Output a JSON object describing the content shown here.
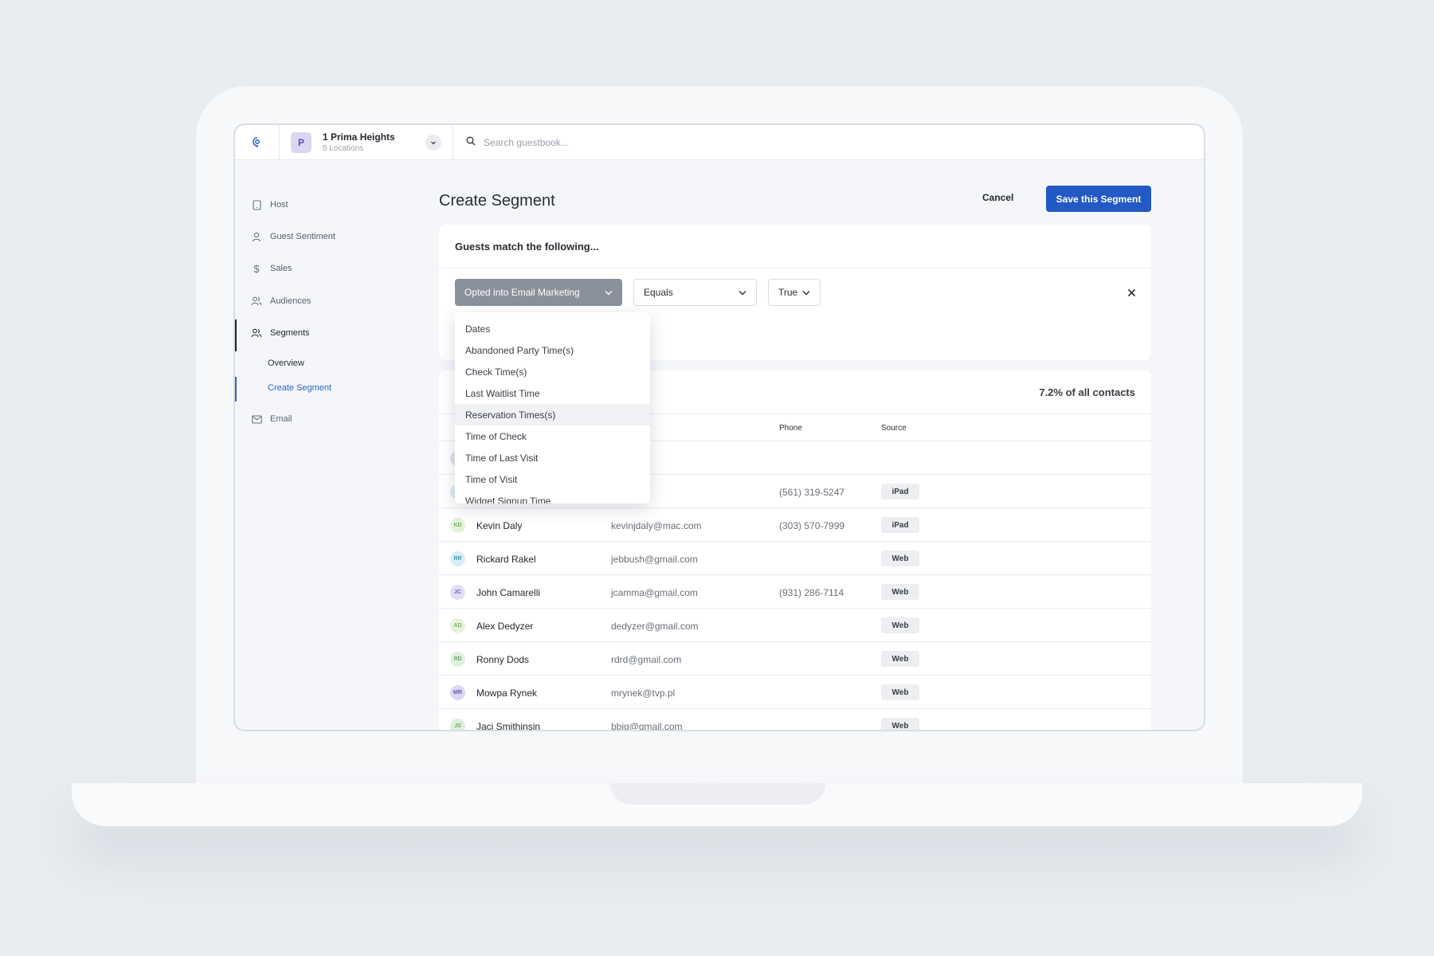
{
  "app": {
    "location_avatar": "P",
    "location_name": "1 Prima Heights",
    "location_sub": "5 Locations",
    "search_placeholder": "Search guestbook..."
  },
  "sidebar": {
    "items": [
      {
        "label": "Host",
        "icon": "tablet-icon"
      },
      {
        "label": "Guest Sentiment",
        "icon": "user-icon"
      },
      {
        "label": "Sales",
        "icon": "dollar-icon"
      },
      {
        "label": "Audiences",
        "icon": "users-icon"
      },
      {
        "label": "Segments",
        "icon": "users-icon"
      },
      {
        "label": "Email",
        "icon": "mail-icon"
      }
    ],
    "sub_items": [
      "Overview",
      "Create Segment"
    ]
  },
  "main": {
    "title": "Create Segment",
    "cancel_label": "Cancel",
    "save_label": "Save this Segment",
    "rule_header": "Guests match the following...",
    "field_value": "Opted into Email Marketing",
    "operator_value": "Equals",
    "value_value": "True",
    "match_percent": "7.2% of all contacts",
    "columns": {
      "phone": "Phone",
      "source": "Source"
    }
  },
  "dropdown": {
    "items": [
      "Dates",
      "Abandoned Party Time(s)",
      "Check Time(s)",
      "Last Waitlist Time",
      "Reservation Times(s)",
      "Time of Check",
      "Time of Last Visit",
      "Time of Visit",
      "Widget Signup Time"
    ],
    "highlighted": "Reservation Times(s)"
  },
  "rows": [
    {
      "initials": "",
      "name": "",
      "email": "",
      "phone": "",
      "source": "",
      "avatar_bg": "#e6e0f5",
      "avatar_fg": "#7a6cc0"
    },
    {
      "initials": "",
      "name": "",
      "email": "",
      "phone": "(561) 319-5247",
      "source": "iPad",
      "avatar_bg": "#d9eef3",
      "avatar_fg": "#4a9ab0"
    },
    {
      "initials": "KD",
      "name": "Kevin Daly",
      "email": "kevinjdaly@mac.com",
      "phone": "(303) 570-7999",
      "source": "iPad",
      "avatar_bg": "#e4f2dc",
      "avatar_fg": "#7aa864"
    },
    {
      "initials": "RR",
      "name": "Rickard Rakel",
      "email": "jebbush@gmail.com",
      "phone": "",
      "source": "Web",
      "avatar_bg": "#d9eef3",
      "avatar_fg": "#4a9ab0"
    },
    {
      "initials": "JC",
      "name": "John Camarelli",
      "email": "jcamma@gmail.com",
      "phone": "(931) 286-7114",
      "source": "Web",
      "avatar_bg": "#e2ddf3",
      "avatar_fg": "#6f62b4"
    },
    {
      "initials": "AD",
      "name": "Alex Dedyzer",
      "email": "dedyzer@gmail.com",
      "phone": "",
      "source": "Web",
      "avatar_bg": "#e7f2dc",
      "avatar_fg": "#86ac6a"
    },
    {
      "initials": "RD",
      "name": "Ronny Dods",
      "email": "rdrd@gmail.com",
      "phone": "",
      "source": "Web",
      "avatar_bg": "#dff0df",
      "avatar_fg": "#6ea870"
    },
    {
      "initials": "MR",
      "name": "Mowpa Rynek",
      "email": "mrynek@tvp.pl",
      "phone": "",
      "source": "Web",
      "avatar_bg": "#ddd8f1",
      "avatar_fg": "#6458ac"
    },
    {
      "initials": "JS",
      "name": "Jaci Smithinsin",
      "email": "bbjg@gmail.com",
      "phone": "",
      "source": "Web",
      "avatar_bg": "#dfeedd",
      "avatar_fg": "#6ea870"
    }
  ]
}
